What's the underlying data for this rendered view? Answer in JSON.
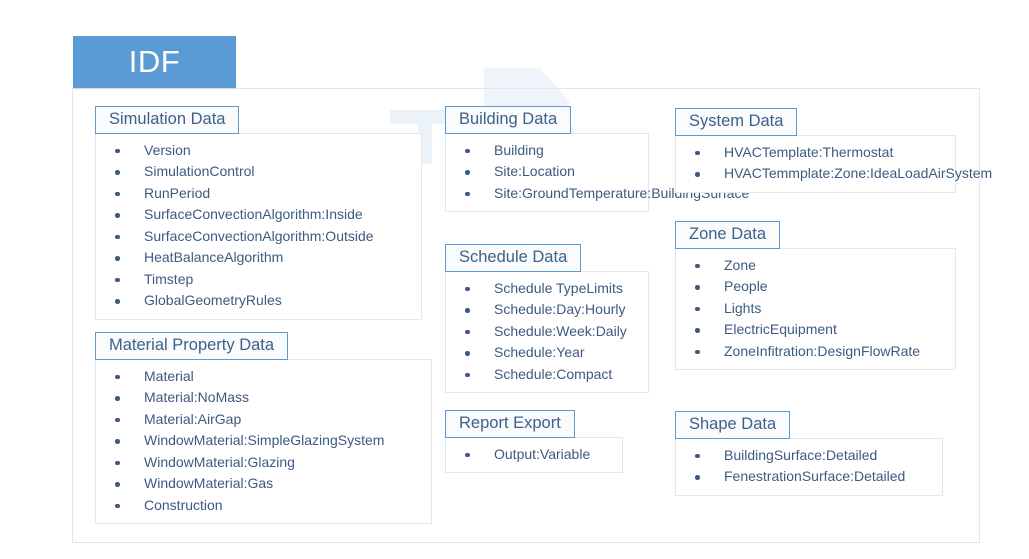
{
  "banner": {
    "label": "IDF",
    "bg_color": "#5b9bd5",
    "text_color": "#ffffff"
  },
  "theme": {
    "title_border_color": "#5b9bd5",
    "title_text_color": "#3d6189",
    "item_text_color": "#3d5a80",
    "box_border_color": "#e4e7eb",
    "frame_border_color": "#e2e5ea",
    "watermark_color": "#c3d7ec"
  },
  "watermark": {
    "text": "TIA"
  },
  "groups": {
    "simulation": {
      "title": "Simulation Data",
      "items": [
        "Version",
        "SimulationControl",
        "RunPeriod",
        "SurfaceConvectionAlgorithm:Inside",
        "SurfaceConvectionAlgorithm:Outside",
        "HeatBalanceAlgorithm",
        "Timstep",
        "GlobalGeometryRules"
      ]
    },
    "material": {
      "title": "Material Property Data",
      "items": [
        "Material",
        "Material:NoMass",
        "Material:AirGap",
        "WindowMaterial:SimpleGlazingSystem",
        "WindowMaterial:Glazing",
        "WindowMaterial:Gas",
        "Construction"
      ]
    },
    "building": {
      "title": "Building Data",
      "items": [
        "Building",
        "Site:Location",
        "Site:GroundTemperature:BuildingSurface"
      ]
    },
    "schedule": {
      "title": "Schedule Data",
      "items": [
        "Schedule TypeLimits",
        "Schedule:Day:Hourly",
        "Schedule:Week:Daily",
        "Schedule:Year",
        "Schedule:Compact"
      ]
    },
    "report": {
      "title": "Report Export",
      "items": [
        "Output:Variable"
      ]
    },
    "system": {
      "title": "System Data",
      "items": [
        "HVACTemplate:Thermostat",
        "HVACTemmplate:Zone:IdeaLoadAirSystem"
      ]
    },
    "zone": {
      "title": "Zone Data",
      "items": [
        "Zone",
        "People",
        "Lights",
        "ElectricEquipment",
        "ZoneInfitration:DesignFlowRate"
      ]
    },
    "shape": {
      "title": "Shape Data",
      "items": [
        "BuildingSurface:Detailed",
        "FenestrationSurface:Detailed"
      ]
    }
  }
}
